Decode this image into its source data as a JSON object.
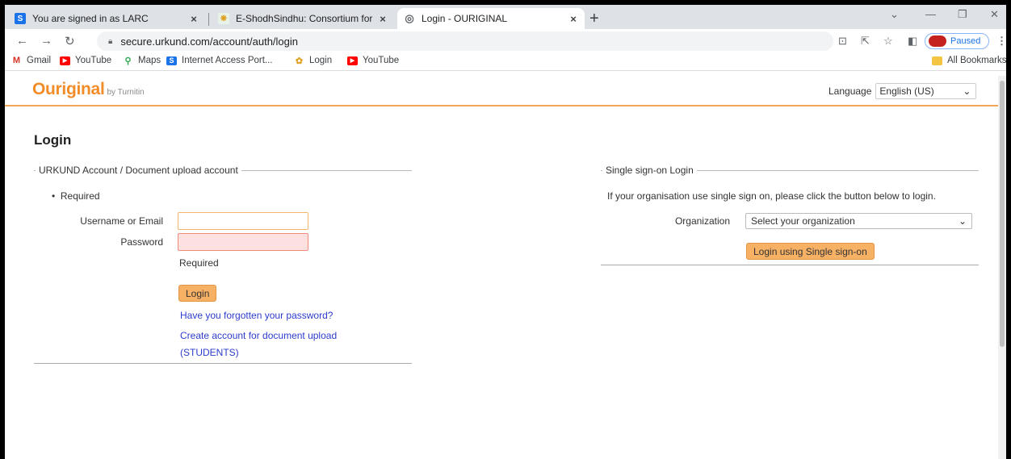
{
  "browser": {
    "tabs": [
      {
        "favicon": "S",
        "title": "You are signed in as LARC",
        "close": "×"
      },
      {
        "favicon": "❋",
        "title": "E-ShodhSindhu: Consortium for",
        "close": "×"
      },
      {
        "favicon": "◎",
        "title": "Login - OURIGINAL",
        "close": "×"
      }
    ],
    "new_tab": "+",
    "url": "secure.urkund.com/account/auth/login",
    "profile_status": "Paused",
    "bookmarks": [
      {
        "icon": "M",
        "label": "Gmail"
      },
      {
        "icon": "▶",
        "label": "YouTube"
      },
      {
        "icon": "⚲",
        "label": "Maps"
      },
      {
        "icon": "S",
        "label": "Internet Access Port..."
      },
      {
        "icon": "✿",
        "label": "Login"
      },
      {
        "icon": "▶",
        "label": "YouTube"
      }
    ],
    "all_bookmarks": "All Bookmarks"
  },
  "header": {
    "logo": "Ouriginal",
    "logo_by": "by Turnitin",
    "language_label": "Language",
    "language_value": "English (US)"
  },
  "main": {
    "title": "Login",
    "account_section": {
      "legend": "URKUND Account / Document upload account",
      "required_note": "Required",
      "username_label": "Username or Email",
      "password_label": "Password",
      "password_error": "Required",
      "login_button": "Login",
      "forgot_link": "Have you forgotten your password?",
      "create_link_line1": "Create account for document upload",
      "create_link_line2": "(STUDENTS)"
    },
    "sso_section": {
      "legend": "Single sign-on Login",
      "description": "If your organisation use single sign on, please click the button below to login.",
      "organization_label": "Organization",
      "organization_placeholder": "Select your organization",
      "sso_button": "Login using Single sign-on"
    }
  },
  "colors": {
    "accent": "#f28c28",
    "button": "#f7b165",
    "link": "#2c3ccc",
    "error_field": "#fde0e0"
  }
}
